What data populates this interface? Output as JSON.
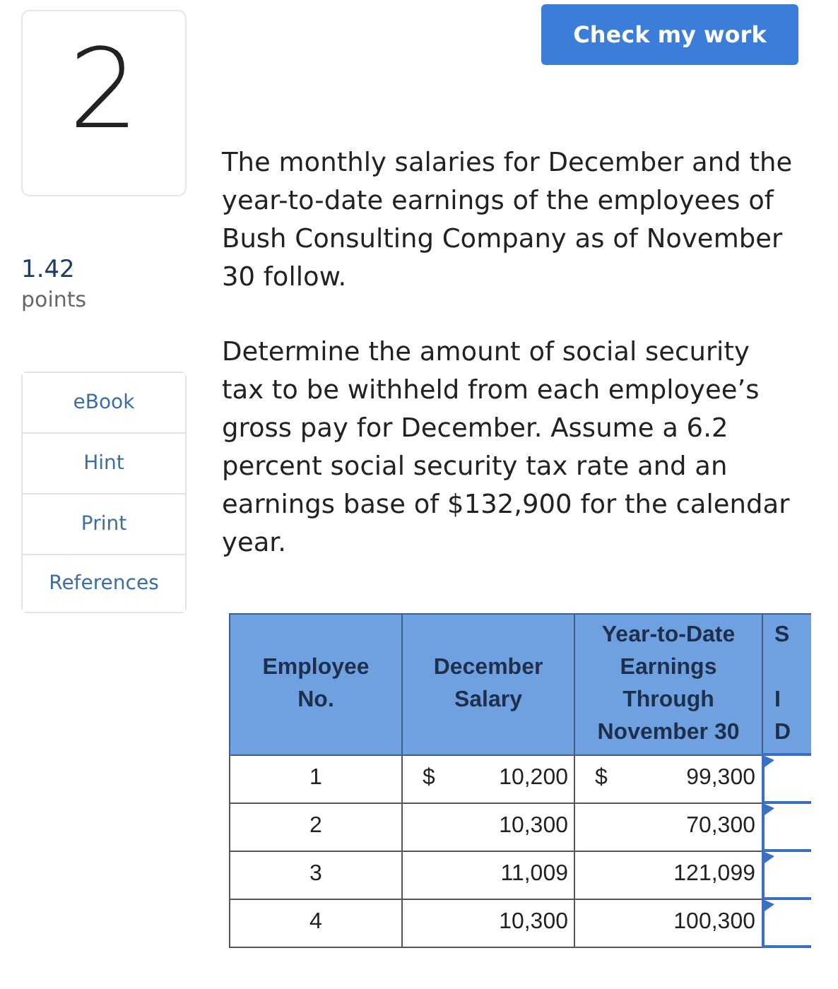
{
  "question": {
    "number": "2",
    "score": "1.42",
    "score_unit": "points"
  },
  "tools": [
    {
      "label": "eBook"
    },
    {
      "label": "Hint"
    },
    {
      "label": "Print"
    },
    {
      "label": "References"
    }
  ],
  "check_button": {
    "label": "Check my work"
  },
  "paragraphs": [
    "The monthly salaries for December and the year-to-date earnings of the employees of Bush Consulting Company as of November 30 follow.",
    "Determine the amount of social security tax to be withheld from each employee’s gross pay for December. Assume a 6.2 percent social security tax rate and an earnings base of $132,900 for the calendar year."
  ],
  "table": {
    "columns": [
      {
        "lines": [
          "Employee",
          "No."
        ]
      },
      {
        "lines": [
          "December",
          "Salary"
        ]
      },
      {
        "lines": [
          "Year-to-Date",
          "Earnings",
          "Through",
          "November 30"
        ]
      },
      {
        "lines": [
          "S",
          "I",
          "D"
        ]
      }
    ],
    "rows": [
      {
        "employee": "1",
        "salary_currency": "$",
        "salary": "10,200",
        "ytd_currency": "$",
        "ytd": "99,300"
      },
      {
        "employee": "2",
        "salary": "10,300",
        "ytd": "70,300"
      },
      {
        "employee": "3",
        "salary": "11,009",
        "ytd": "121,099"
      },
      {
        "employee": "4",
        "salary": "10,300",
        "ytd": "100,300"
      }
    ]
  }
}
